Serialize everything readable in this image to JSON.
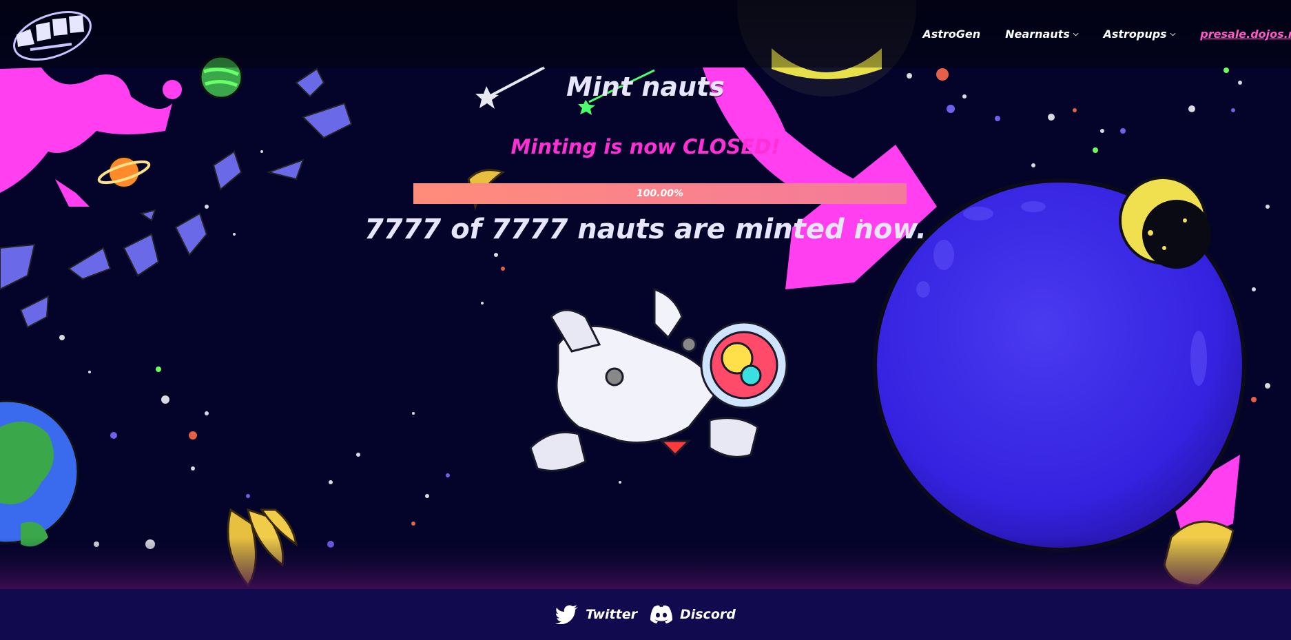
{
  "header": {
    "logo_alt": "Nearnauts",
    "nav": [
      {
        "label": "AstroGen",
        "dropdown": false
      },
      {
        "label": "Nearnauts",
        "dropdown": true
      },
      {
        "label": "Astropups",
        "dropdown": true
      }
    ],
    "site_link": "presale.dojos.ne"
  },
  "main": {
    "title": "Mint nauts",
    "status": "Minting is now CLOSED!",
    "progress": {
      "fraction": 1.0,
      "label": "100.00%"
    },
    "minted_text": "7777 of 7777 nauts are minted now."
  },
  "footer": {
    "links": [
      {
        "label": "Twitter",
        "icon": "twitter-icon"
      },
      {
        "label": "Discord",
        "icon": "discord-icon"
      }
    ]
  },
  "colors": {
    "background": "#04042a",
    "accent_pink": "#ff2fd6",
    "progress_start": "#ff8c7a",
    "progress_end": "#f47a9c",
    "footer": "#120a4f",
    "planet_blue": "#3a22e6"
  }
}
